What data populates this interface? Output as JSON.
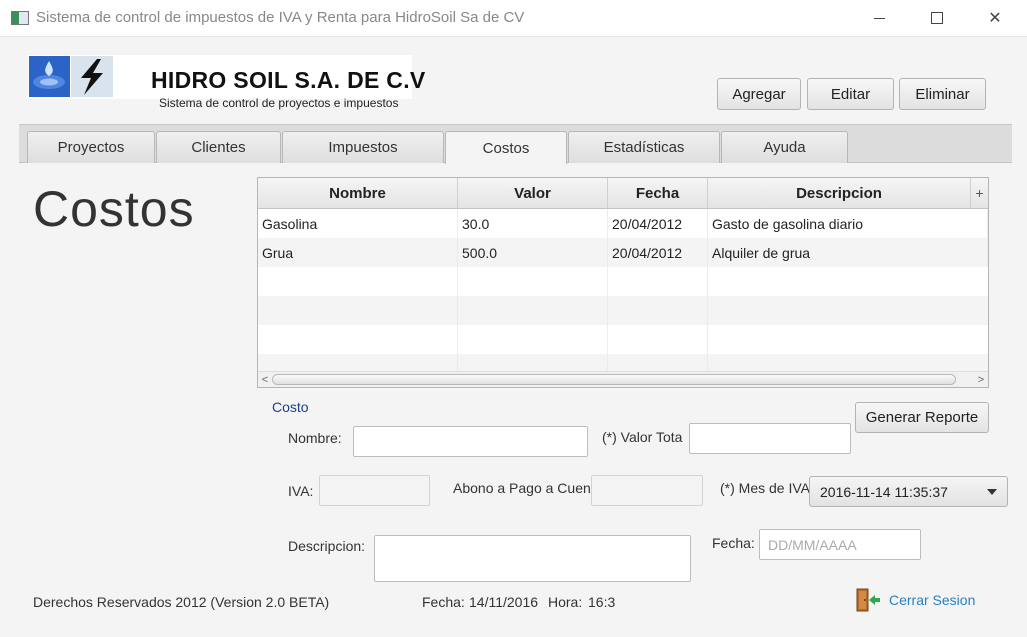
{
  "window": {
    "title": "Sistema de control de impuestos de IVA y Renta para HidroSoil Sa de CV",
    "minimize_icon": "minimize-icon",
    "maximize_icon": "maximize-icon",
    "close_icon": "close-icon",
    "close_glyph": "✕"
  },
  "header": {
    "company": "HIDRO SOIL S.A. DE C.V",
    "subtitle": "Sistema de control de proyectos e impuestos",
    "logo_icon": "water-drop-lightning-logo"
  },
  "toolbar": {
    "add_label": "Agregar",
    "edit_label": "Editar",
    "delete_label": "Eliminar"
  },
  "tabs": [
    {
      "label": "Proyectos"
    },
    {
      "label": "Clientes"
    },
    {
      "label": "Impuestos"
    },
    {
      "label": "Costos",
      "active": true
    },
    {
      "label": "Estadísticas"
    },
    {
      "label": "Ayuda"
    }
  ],
  "page": {
    "heading": "Costos"
  },
  "table": {
    "columns": [
      "Nombre",
      "Valor",
      "Fecha",
      "Descripcion"
    ],
    "menu_glyph": "+",
    "rows": [
      [
        "Gasolina",
        "30.0",
        "20/04/2012",
        "Gasto de gasolina diario"
      ],
      [
        "Grua",
        "500.0",
        "20/04/2012",
        "Alquiler de grua"
      ]
    ],
    "scroll_left": "<",
    "scroll_right": ">"
  },
  "form": {
    "section_title": "Costo",
    "nombre_label": "Nombre:",
    "nombre_value": "",
    "valor_total_label": "(*) Valor Tota",
    "valor_total_value": "",
    "generar_label": "Generar Reporte",
    "iva_label": "IVA:",
    "iva_value": "",
    "abono_label": "Abono a Pago a Cuenta:",
    "abono_value": "",
    "mes_iva_label": "(*) Mes de IVA",
    "mes_iva_value": "2016-11-14 11:35:37",
    "descripcion_label": "Descripcion:",
    "descripcion_value": "",
    "fecha_label": "Fecha:",
    "fecha_placeholder": "DD/MM/AAAA"
  },
  "footer": {
    "copyright": "Derechos Reservados 2012 (Version 2.0 BETA)",
    "fecha_label": "Fecha:",
    "fecha_value": "14/11/2016",
    "hora_label": "Hora:",
    "hora_value": "16:3",
    "logout_label": "Cerrar Sesion",
    "logout_icon": "door-exit-icon"
  },
  "colors": {
    "accent_link": "#2a7fc1",
    "section_title": "#1b3f8a"
  }
}
